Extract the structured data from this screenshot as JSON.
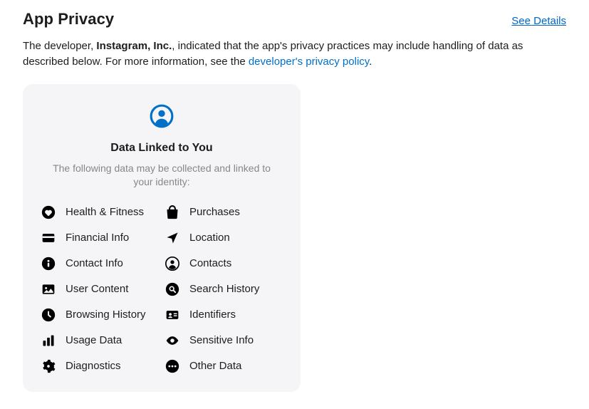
{
  "header": {
    "title": "App Privacy",
    "see_details": "See Details"
  },
  "description": {
    "prefix": "The developer, ",
    "developer": "Instagram, Inc.",
    "middle": ", indicated that the app's privacy practices may include handling of data as described below. For more information, see the ",
    "link_text": "developer's privacy policy",
    "suffix": "."
  },
  "card": {
    "title": "Data Linked to You",
    "subtitle": "The following data may be collected and linked to your identity:",
    "items_left": [
      {
        "icon": "heart-circle-icon",
        "label": "Health & Fitness"
      },
      {
        "icon": "credit-card-icon",
        "label": "Financial Info"
      },
      {
        "icon": "info-circle-icon",
        "label": "Contact Info"
      },
      {
        "icon": "photo-icon",
        "label": "User Content"
      },
      {
        "icon": "clock-icon",
        "label": "Browsing History"
      },
      {
        "icon": "bar-chart-icon",
        "label": "Usage Data"
      },
      {
        "icon": "gear-icon",
        "label": "Diagnostics"
      }
    ],
    "items_right": [
      {
        "icon": "bag-icon",
        "label": "Purchases"
      },
      {
        "icon": "location-arrow-icon",
        "label": "Location"
      },
      {
        "icon": "contacts-circle-icon",
        "label": "Contacts"
      },
      {
        "icon": "search-circle-icon",
        "label": "Search History"
      },
      {
        "icon": "id-card-icon",
        "label": "Identifiers"
      },
      {
        "icon": "eye-icon",
        "label": "Sensitive Info"
      },
      {
        "icon": "ellipsis-circle-icon",
        "label": "Other Data"
      }
    ]
  }
}
